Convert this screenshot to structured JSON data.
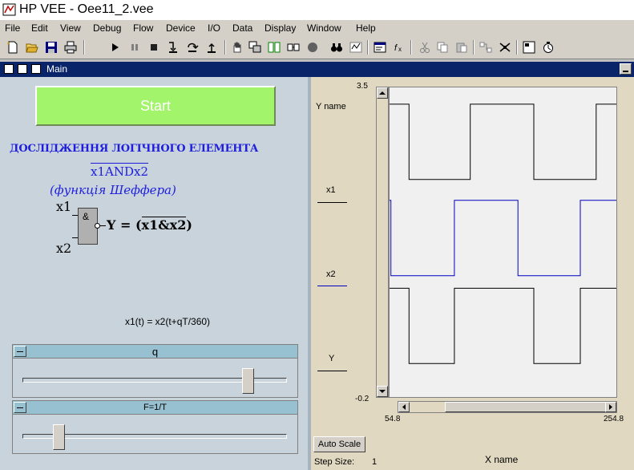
{
  "window": {
    "title": "HP VEE - Oee11_2.vee"
  },
  "menu": [
    "File",
    "Edit",
    "View",
    "Debug",
    "Flow",
    "Device",
    "I/O",
    "Data",
    "Display",
    "Window",
    "Help"
  ],
  "subwindow": {
    "title": "Main"
  },
  "panel": {
    "start_label": "Start",
    "heading": "ДОСЛІДЖЕННЯ ЛОГІЧНОГО ЕЛЕМЕНТА",
    "formula": "x1ANDx2",
    "subtitle": "(функція Шеффера)",
    "gate": {
      "input1": "x1",
      "input2": "x2",
      "symbol": "&",
      "output_prefix": "Y = (",
      "output_expr": "x1&x2",
      "output_suffix": ")"
    },
    "equation": "x1(t) = x2(t+qT/360)",
    "sliders": [
      {
        "name": "q",
        "position": 0.87
      },
      {
        "name": "F=1/T",
        "position": 0.12
      }
    ]
  },
  "graph": {
    "y_name": "Y name",
    "x_name": "X name",
    "y_max_label": "3.5",
    "y_min_label": "-0.2",
    "x_min_label": "54.8",
    "x_max_label": "254.8",
    "autoscale_label": "Auto Scale",
    "step_size_label": "Step Size:",
    "step_size_value": "1",
    "traces": [
      {
        "name": "x1",
        "color": "#000000"
      },
      {
        "name": "x2",
        "color": "#0000c0"
      },
      {
        "name": "Y",
        "color": "#000000"
      }
    ]
  },
  "chart_data": {
    "type": "line",
    "x_range": [
      54.8,
      254.8
    ],
    "y_range": [
      -0.2,
      3.5
    ],
    "xlabel": "X name",
    "ylabel": "Y name",
    "series": [
      {
        "name": "x1",
        "color": "#000000",
        "points": [
          [
            54.8,
            3.3
          ],
          [
            72,
            3.3
          ],
          [
            72,
            2.4
          ],
          [
            126,
            2.4
          ],
          [
            126,
            3.3
          ],
          [
            182,
            3.3
          ],
          [
            182,
            2.4
          ],
          [
            237,
            2.4
          ],
          [
            237,
            3.3
          ],
          [
            254.8,
            3.3
          ]
        ]
      },
      {
        "name": "x2",
        "color": "#0000c0",
        "points": [
          [
            54.8,
            2.15
          ],
          [
            56,
            2.15
          ],
          [
            56,
            1.25
          ],
          [
            112,
            1.25
          ],
          [
            112,
            2.15
          ],
          [
            168,
            2.15
          ],
          [
            168,
            1.25
          ],
          [
            223,
            1.25
          ],
          [
            223,
            2.15
          ],
          [
            254.8,
            2.15
          ]
        ]
      },
      {
        "name": "Y",
        "color": "#000000",
        "points": [
          [
            54.8,
            1.1
          ],
          [
            72,
            1.1
          ],
          [
            72,
            0.2
          ],
          [
            112,
            0.2
          ],
          [
            112,
            1.1
          ],
          [
            182,
            1.1
          ],
          [
            182,
            0.2
          ],
          [
            223,
            0.2
          ],
          [
            223,
            1.1
          ],
          [
            254.8,
            1.1
          ]
        ]
      }
    ]
  }
}
